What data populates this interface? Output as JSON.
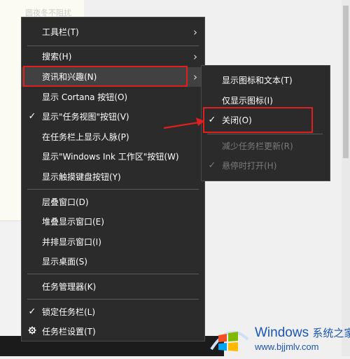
{
  "background": {
    "faint_text": "圆夜冬不阻扰"
  },
  "menu": {
    "items": [
      {
        "label": "工具栏(T)",
        "has_submenu": true
      },
      {
        "label": "搜索(H)",
        "has_submenu": true
      },
      {
        "label": "资讯和兴趣(N)",
        "has_submenu": true,
        "highlighted": true
      },
      {
        "label": "显示 Cortana 按钮(O)"
      },
      {
        "label": "显示\"任务视图\"按钮(V)",
        "checked": true
      },
      {
        "label": "在任务栏上显示人脉(P)"
      },
      {
        "label": "显示\"Windows Ink 工作区\"按钮(W)"
      },
      {
        "label": "显示触摸键盘按钮(Y)"
      },
      {
        "label": "层叠窗口(D)"
      },
      {
        "label": "堆叠显示窗口(E)"
      },
      {
        "label": "并排显示窗口(I)"
      },
      {
        "label": "显示桌面(S)"
      },
      {
        "label": "任务管理器(K)"
      },
      {
        "label": "锁定任务栏(L)",
        "checked": true
      },
      {
        "label": "任务栏设置(T)",
        "icon": "gear-icon"
      }
    ],
    "check_glyph": "✓",
    "arrow_glyph": "›"
  },
  "submenu": {
    "items": [
      {
        "label": "显示图标和文本(T)"
      },
      {
        "label": "仅显示图标(I)"
      },
      {
        "label": "关闭(O)",
        "checked": true
      },
      {
        "label": "减少任务栏更新(R)",
        "disabled": true
      },
      {
        "label": "悬停时打开(H)",
        "checked": true,
        "disabled": true
      }
    ]
  },
  "watermark": {
    "brand": "Windows",
    "brand_cn": "系统之家",
    "url": "www.bjjmlv.com"
  },
  "colors": {
    "menu_bg": "#2b2b2b",
    "menu_hover": "#414141",
    "annotation_red": "#e02020",
    "watermark_blue": "#1a56b3"
  }
}
